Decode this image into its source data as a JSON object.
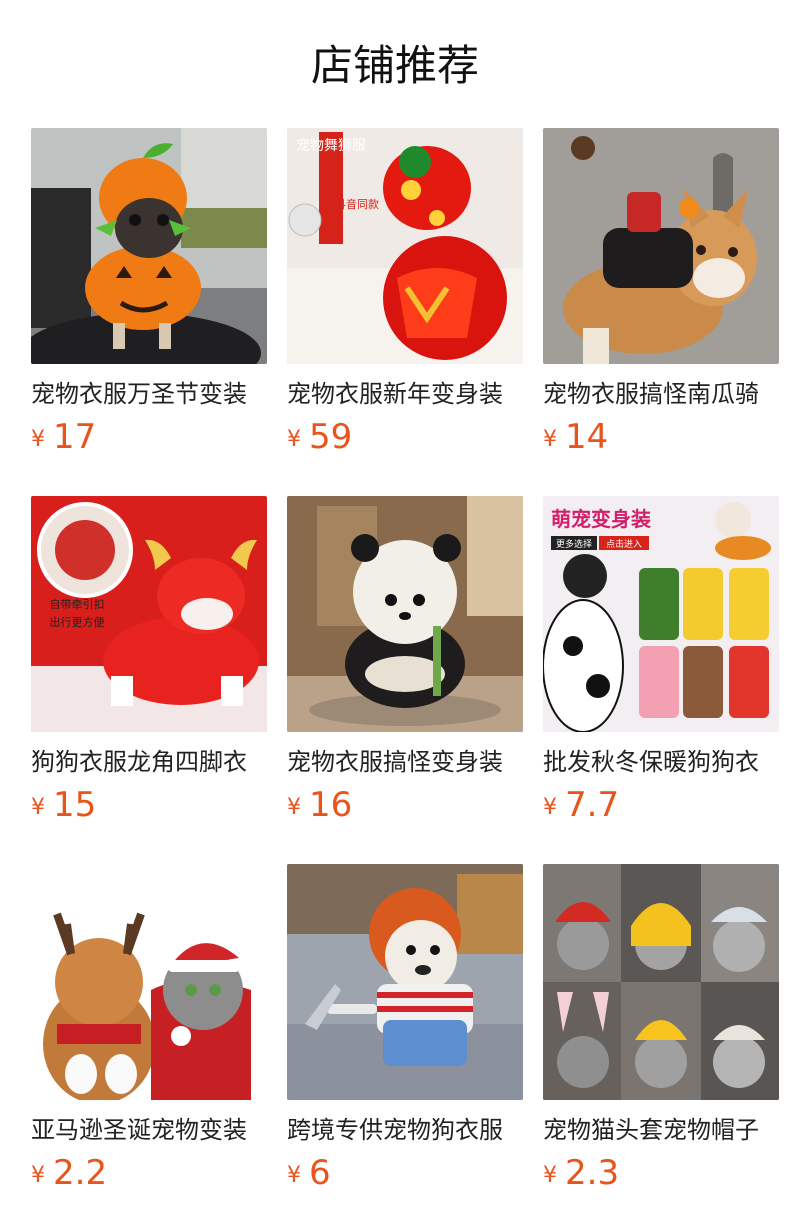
{
  "header": {
    "title": "店铺推荐"
  },
  "currency_symbol": "¥",
  "products": [
    {
      "name": "宠物衣服万圣节变装",
      "price": "17",
      "image_icon": "pug-pumpkin-costume-photo",
      "image_text": []
    },
    {
      "name": "宠物衣服新年变身装",
      "price": "59",
      "image_icon": "dog-lion-dance-costume-photo",
      "image_text": [
        "宠物舞狮服",
        "抖音同款"
      ]
    },
    {
      "name": "宠物衣服搞怪南瓜骑",
      "price": "14",
      "image_icon": "corgi-rider-costume-photo",
      "image_text": []
    },
    {
      "name": "狗狗衣服龙角四脚衣",
      "price": "15",
      "image_icon": "dog-red-dragon-costume-photo",
      "image_text": [
        "自带牵引扣",
        "出行更方便"
      ]
    },
    {
      "name": "宠物衣服搞怪变身装",
      "price": "16",
      "image_icon": "dog-panda-costume-photo",
      "image_text": []
    },
    {
      "name": "批发秋冬保暖狗狗衣",
      "price": "7.7",
      "image_icon": "dog-cow-costume-collage",
      "image_text": [
        "萌宠变身装",
        "更多选择",
        "点击进入"
      ]
    },
    {
      "name": "亚马逊圣诞宠物变装",
      "price": "2.2",
      "image_icon": "cats-christmas-costume-photo",
      "image_text": []
    },
    {
      "name": "跨境专供宠物狗衣服",
      "price": "6",
      "image_icon": "bulldog-chucky-costume-photo",
      "image_text": []
    },
    {
      "name": "宠物猫头套宠物帽子",
      "price": "2.3",
      "image_icon": "cats-hat-collage",
      "image_text": []
    }
  ],
  "colors": {
    "price": "#e8541a",
    "title": "#111111",
    "name": "#222222"
  }
}
